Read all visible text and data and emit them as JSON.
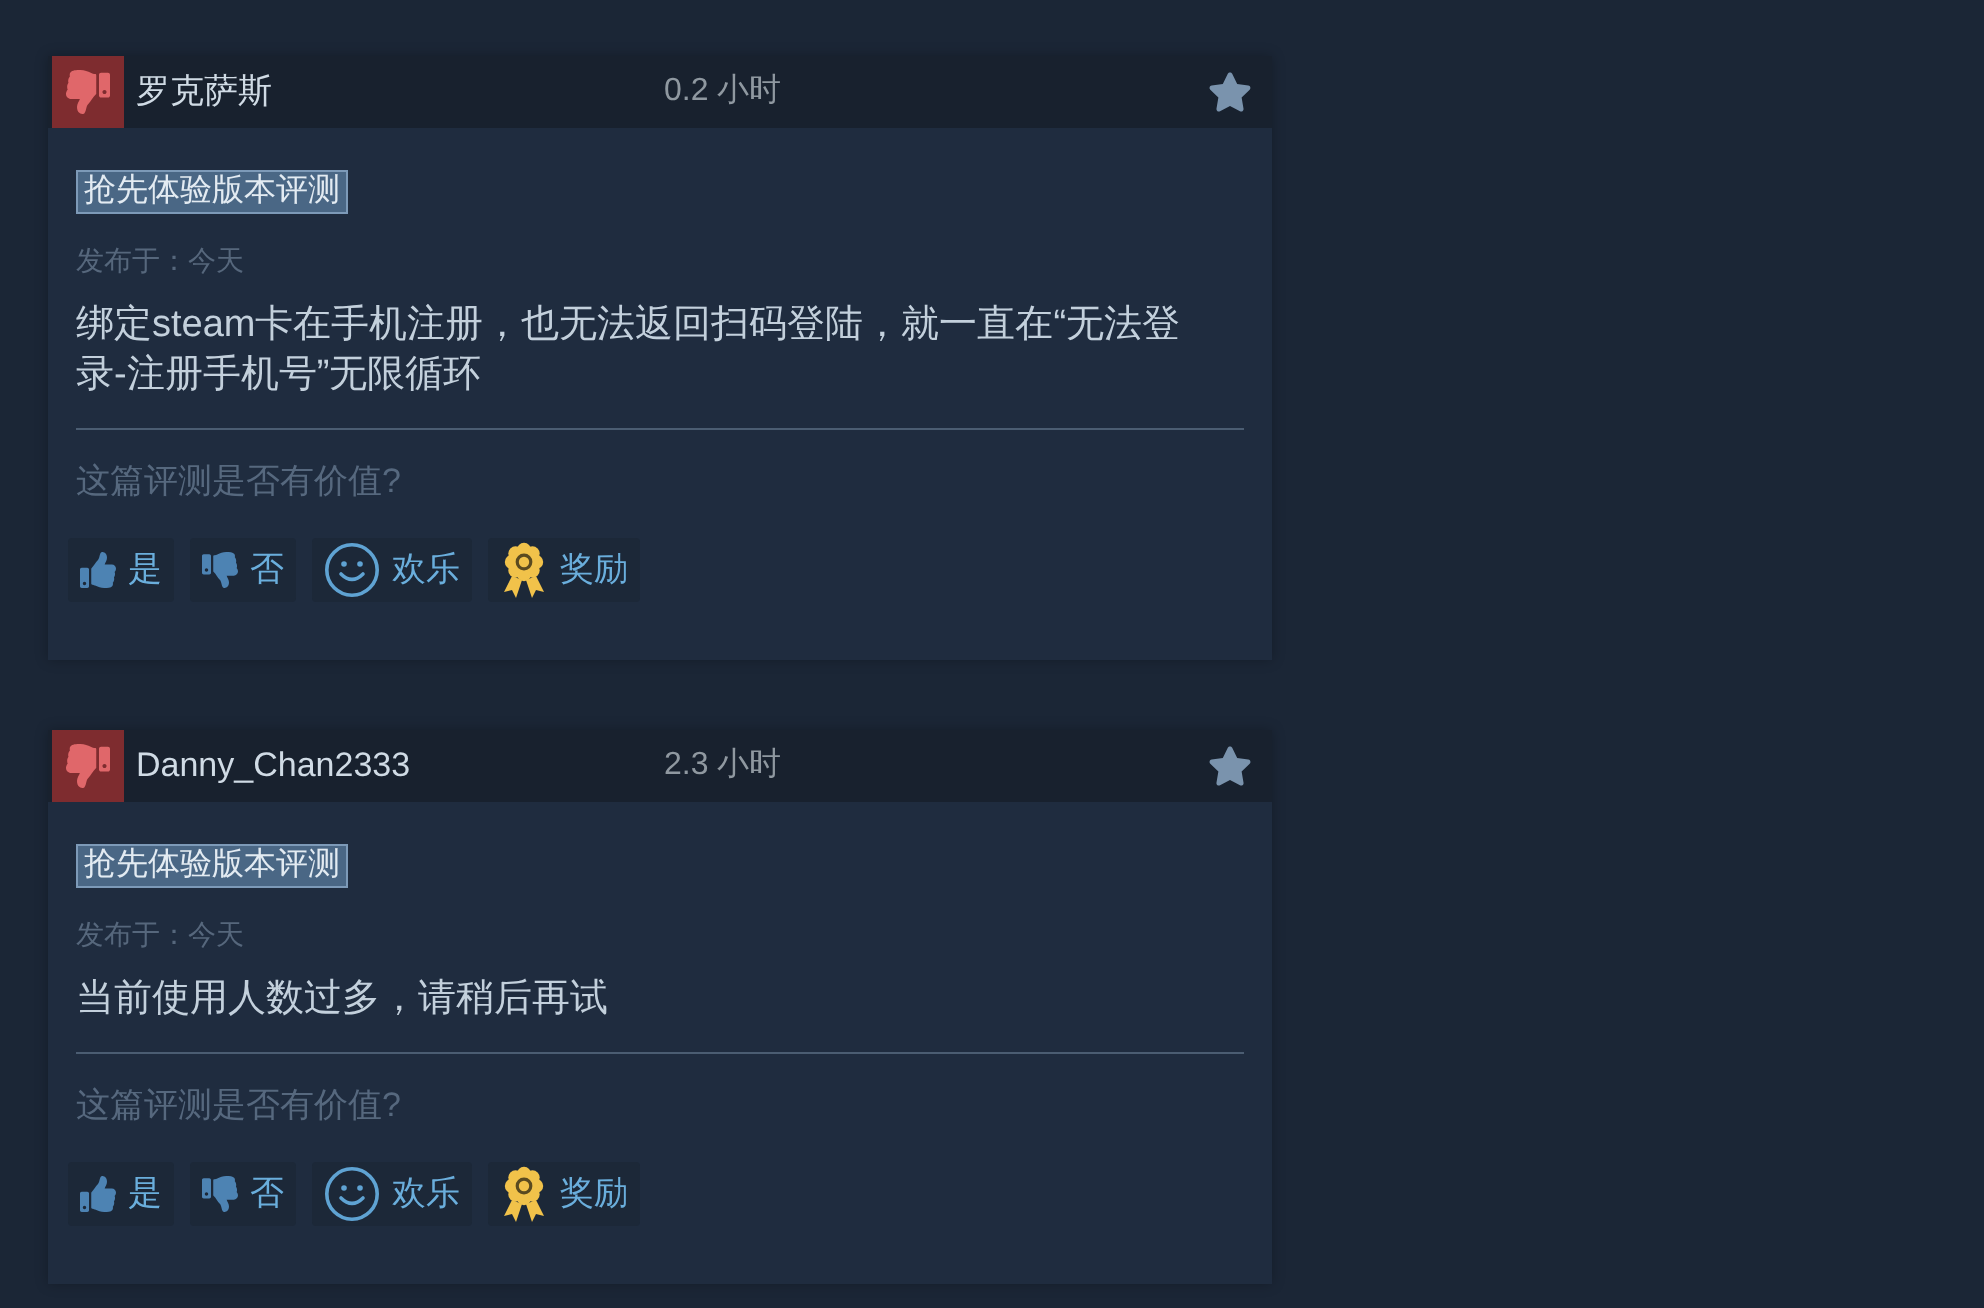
{
  "reviews": [
    {
      "recommended": false,
      "author": "罗克萨斯",
      "playtime": "0.2 小时",
      "tag": "抢先体验版本评测",
      "posted": "发布于：今天",
      "text": "绑定steam卡在手机注册，也无法返回扫码登陆，就一直在“无法登录-注册手机号”无限循环",
      "helpful_prompt": "这篇评测是否有价值?",
      "actions": [
        {
          "kind": "yes",
          "label": "是"
        },
        {
          "kind": "no",
          "label": "否"
        },
        {
          "kind": "funny",
          "label": "欢乐"
        },
        {
          "kind": "award",
          "label": "奖励"
        }
      ]
    },
    {
      "recommended": false,
      "author": "Danny_Chan2333",
      "playtime": "2.3 小时",
      "tag": "抢先体验版本评测",
      "posted": "发布于：今天",
      "text": "当前使用人数过多，请稍后再试",
      "helpful_prompt": "这篇评测是否有价值?",
      "actions": [
        {
          "kind": "yes",
          "label": "是"
        },
        {
          "kind": "no",
          "label": "否"
        },
        {
          "kind": "funny",
          "label": "欢乐"
        },
        {
          "kind": "award",
          "label": "奖励"
        }
      ]
    }
  ]
}
